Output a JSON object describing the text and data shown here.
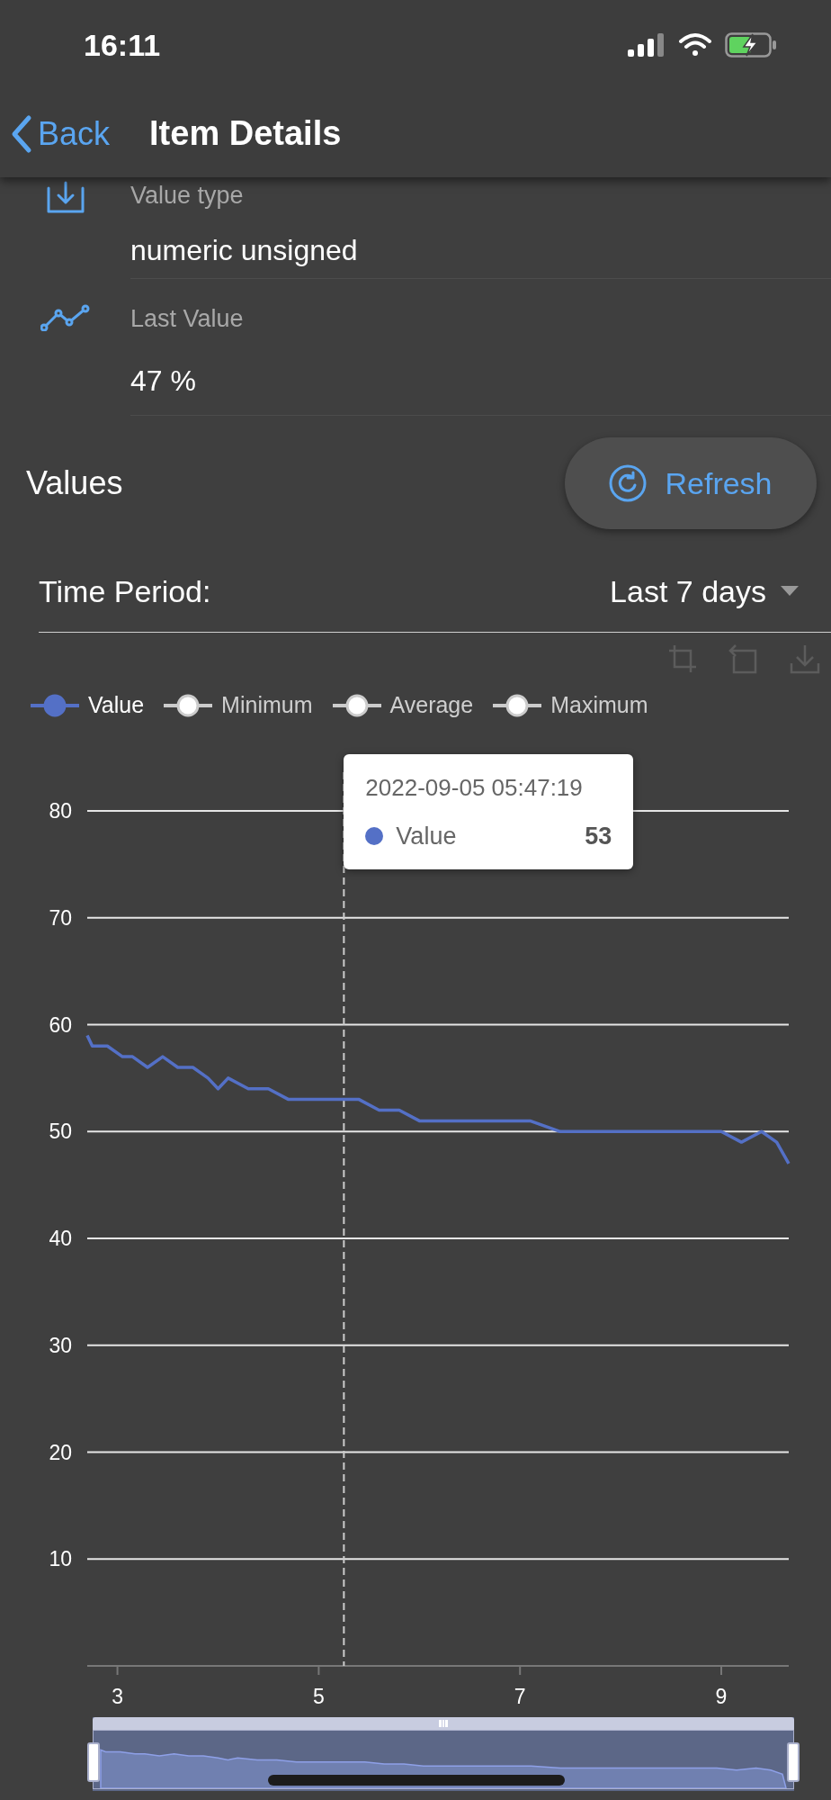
{
  "status_bar": {
    "time": "16:11"
  },
  "nav": {
    "back": "Back",
    "title": "Item Details"
  },
  "details": [
    {
      "kind": "download",
      "label": "Value type",
      "value": "numeric unsigned"
    },
    {
      "kind": "trend",
      "label": "Last Value",
      "value": "47 %"
    }
  ],
  "values": {
    "title": "Values",
    "refresh": "Refresh"
  },
  "time_period": {
    "label": "Time Period:",
    "value": "Last 7 days"
  },
  "legend": [
    {
      "label": "Value",
      "active": true
    },
    {
      "label": "Minimum",
      "active": false
    },
    {
      "label": "Average",
      "active": false
    },
    {
      "label": "Maximum",
      "active": false
    }
  ],
  "chart": {
    "tooltip": {
      "time": "2022-09-05 05:47:19",
      "series": "Value",
      "value": "53"
    },
    "chart_data": {
      "type": "line",
      "grid": true,
      "xlim": [
        2.7,
        9.67
      ],
      "ylim": [
        0,
        80
      ],
      "xticks": [
        3,
        5,
        7,
        9
      ],
      "yticks": [
        10,
        20,
        30,
        40,
        50,
        60,
        70,
        80
      ],
      "ref_lines": [
        {
          "axis": "x",
          "value": 5.25
        }
      ],
      "x": [
        2.7,
        2.75,
        2.9,
        3.05,
        3.15,
        3.3,
        3.45,
        3.6,
        3.75,
        3.9,
        4.0,
        4.1,
        4.3,
        4.5,
        4.7,
        4.85,
        5.0,
        5.25,
        5.4,
        5.6,
        5.8,
        6.0,
        6.2,
        6.5,
        6.7,
        6.9,
        7.1,
        7.4,
        7.6,
        7.8,
        8.0,
        8.2,
        8.5,
        8.8,
        9.0,
        9.2,
        9.4,
        9.55,
        9.67
      ],
      "series": [
        {
          "color": "#5470c6",
          "values": [
            59,
            58,
            58,
            57,
            57,
            56,
            57,
            56,
            56,
            55,
            54,
            55,
            54,
            54,
            53,
            53,
            53,
            53,
            53,
            52,
            52,
            51,
            51,
            51,
            51,
            51,
            51,
            50,
            50,
            50,
            50,
            50,
            50,
            50,
            50,
            49,
            50,
            49,
            47
          ]
        }
      ]
    }
  },
  "data_zoom": {
    "level": 1
  }
}
